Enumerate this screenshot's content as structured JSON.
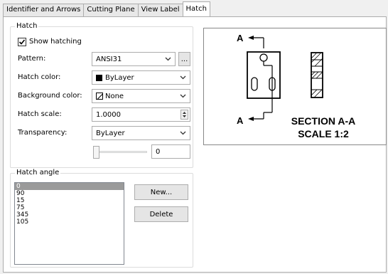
{
  "tabs": [
    "Identifier and Arrows",
    "Cutting Plane",
    "View Label",
    "Hatch"
  ],
  "hatch_group": {
    "title": "Hatch",
    "show_hatching_label": "Show hatching",
    "pattern_label": "Pattern:",
    "pattern_value": "ANSI31",
    "browse_label": "...",
    "hatch_color_label": "Hatch color:",
    "hatch_color_value": "ByLayer",
    "background_color_label": "Background color:",
    "background_color_value": "None",
    "hatch_scale_label": "Hatch scale:",
    "hatch_scale_value": "1.0000",
    "transparency_label": "Transparency:",
    "transparency_value": "ByLayer",
    "transparency_slider_value": "0"
  },
  "angle_group": {
    "title": "Hatch angle",
    "angles": [
      "0",
      "90",
      "15",
      "75",
      "345",
      "105"
    ],
    "new_label": "New...",
    "delete_label": "Delete"
  },
  "preview": {
    "label_a": "A",
    "section": "SECTION A-A",
    "scale": "SCALE 1:2"
  }
}
